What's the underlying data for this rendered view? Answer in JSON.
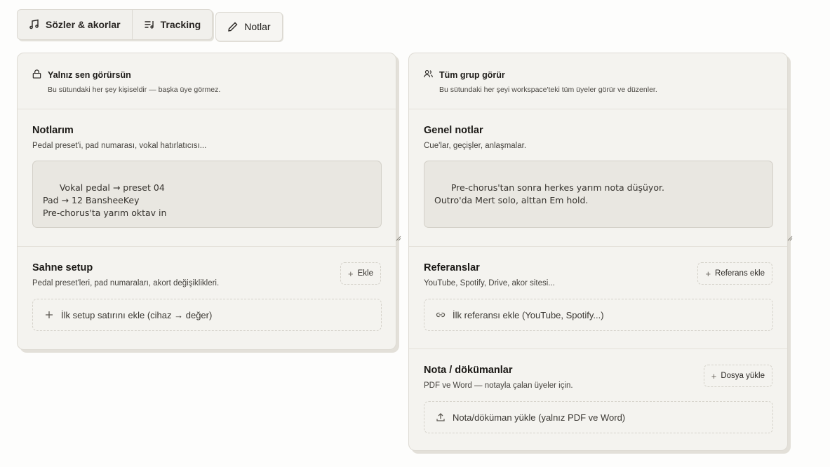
{
  "tabs": [
    {
      "label": "Sözler & akorlar",
      "icon": "music-notes-icon"
    },
    {
      "label": "Tracking",
      "icon": "list-music-icon"
    },
    {
      "label": "Notlar",
      "icon": "pencil-icon",
      "active": true
    }
  ],
  "private_card": {
    "title": "Yalnız sen görürsün",
    "description": "Bu sütundaki her şey kişiseldir — başka üye görmez.",
    "notes": {
      "title": "Notlarım",
      "subtitle": "Pedal preset'i, pad numarası, vokal hatırlatıcısı...",
      "value": "Vokal pedal → preset 04\nPad → 12 BansheeKey\nPre-chorus'ta yarım oktav in"
    },
    "setup": {
      "title": "Sahne setup",
      "subtitle": "Pedal preset'leri, pad numaraları, akort değişiklikleri.",
      "add_label": "Ekle",
      "empty_label": "İlk setup satırını ekle (cihaz → değer)"
    }
  },
  "shared_card": {
    "title": "Tüm grup görür",
    "description": "Bu sütundaki her şeyi workspace'teki tüm üyeler görür ve düzenler.",
    "notes": {
      "title": "Genel notlar",
      "subtitle": "Cue'lar, geçişler, anlaşmalar.",
      "value": "Pre-chorus'tan sonra herkes yarım nota düşüyor.\nOutro'da Mert solo, alttan Em hold."
    },
    "references": {
      "title": "Referanslar",
      "subtitle": "YouTube, Spotify, Drive, akor sitesi...",
      "add_label": "Referans ekle",
      "empty_label": "İlk referansı ekle (YouTube, Spotify...)"
    },
    "documents": {
      "title": "Nota / dökümanlar",
      "subtitle": "PDF ve Word — notayla çalan üyeler için.",
      "add_label": "Dosya yükle",
      "empty_label": "Nota/döküman yükle (yalnız PDF ve Word)"
    }
  }
}
